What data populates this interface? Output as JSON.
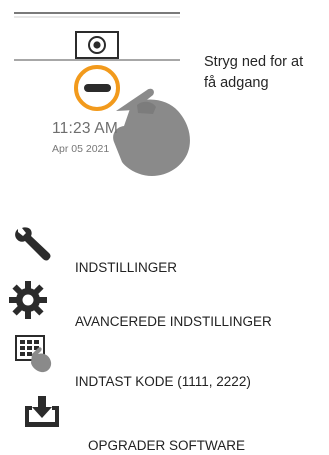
{
  "swipe_hint": {
    "line1": "Stryg ned for at",
    "line2": "få adgang"
  },
  "clock": {
    "time": "11:23 AM",
    "date": "Apr 05 2021"
  },
  "colors": {
    "accent": "#f29a1c",
    "icon": "#2b2b2b",
    "gesture_hand": "#8a8a8a"
  },
  "menu": [
    {
      "icon": "wrench-icon",
      "label": "INDSTILLINGER"
    },
    {
      "icon": "gear-icon",
      "label": "AVANCEREDE INDSTILLINGER"
    },
    {
      "icon": "keypad-hand-icon",
      "label": "INDTAST KODE (1111, 2222)"
    },
    {
      "icon": "download-tray-icon",
      "label": "OPGRADER SOFTWARE"
    }
  ]
}
